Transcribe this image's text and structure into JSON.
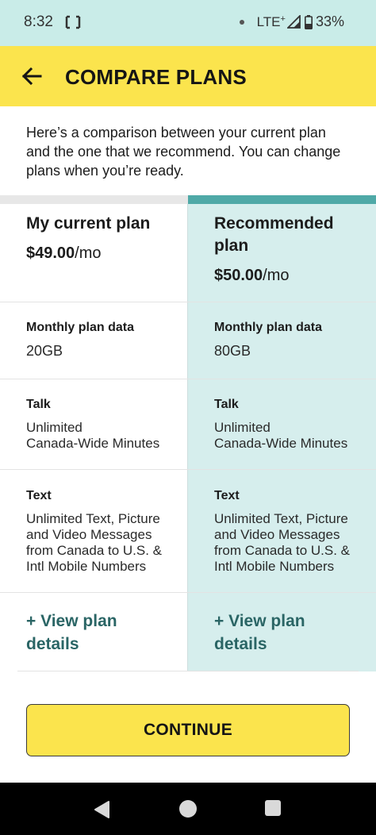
{
  "status_bar": {
    "time": "8:32",
    "network": "LTE",
    "network_sup": "+",
    "battery": "33%"
  },
  "header": {
    "title": "COMPARE PLANS",
    "back_icon": "arrow-left-icon"
  },
  "intro_text": "Here’s a comparison between your current plan and the one that we recommend. You can change plans when you’re ready.",
  "plans": {
    "current": {
      "name": "My current plan",
      "price": "$49.00",
      "price_unit": "/mo",
      "data_label": "Monthly plan data",
      "data_value": "20GB",
      "talk_label": "Talk",
      "talk_line1": "Unlimited",
      "talk_line2": "Canada-Wide Minutes",
      "text_label": "Text",
      "text_line1": "Unlimited Text, Picture",
      "text_line2": "and Video Messages",
      "text_line3": "from Canada to U.S. &",
      "text_line4": "Intl Mobile Numbers",
      "link_line1": "+ View plan",
      "link_line2": "details"
    },
    "recommended": {
      "name_line1": "Recommended",
      "name_line2": "plan",
      "price": "$50.00",
      "price_unit": "/mo",
      "data_label": "Monthly plan data",
      "data_value": "80GB",
      "talk_label": "Talk",
      "talk_line1": "Unlimited",
      "talk_line2": "Canada-Wide Minutes",
      "text_label": "Text",
      "text_line1": "Unlimited Text, Picture",
      "text_line2": "and Video Messages",
      "text_line3": "from Canada to U.S. &",
      "text_line4": "Intl Mobile Numbers",
      "link_line1": "+ View plan",
      "link_line2": "details"
    }
  },
  "continue_label": "CONTINUE",
  "colors": {
    "accent_yellow": "#fbe44d",
    "status_bar_bg": "#c9ece8",
    "recommended_bg": "#d6eeed",
    "recommended_bar": "#4fa9a7",
    "link_color": "#2a6565"
  }
}
